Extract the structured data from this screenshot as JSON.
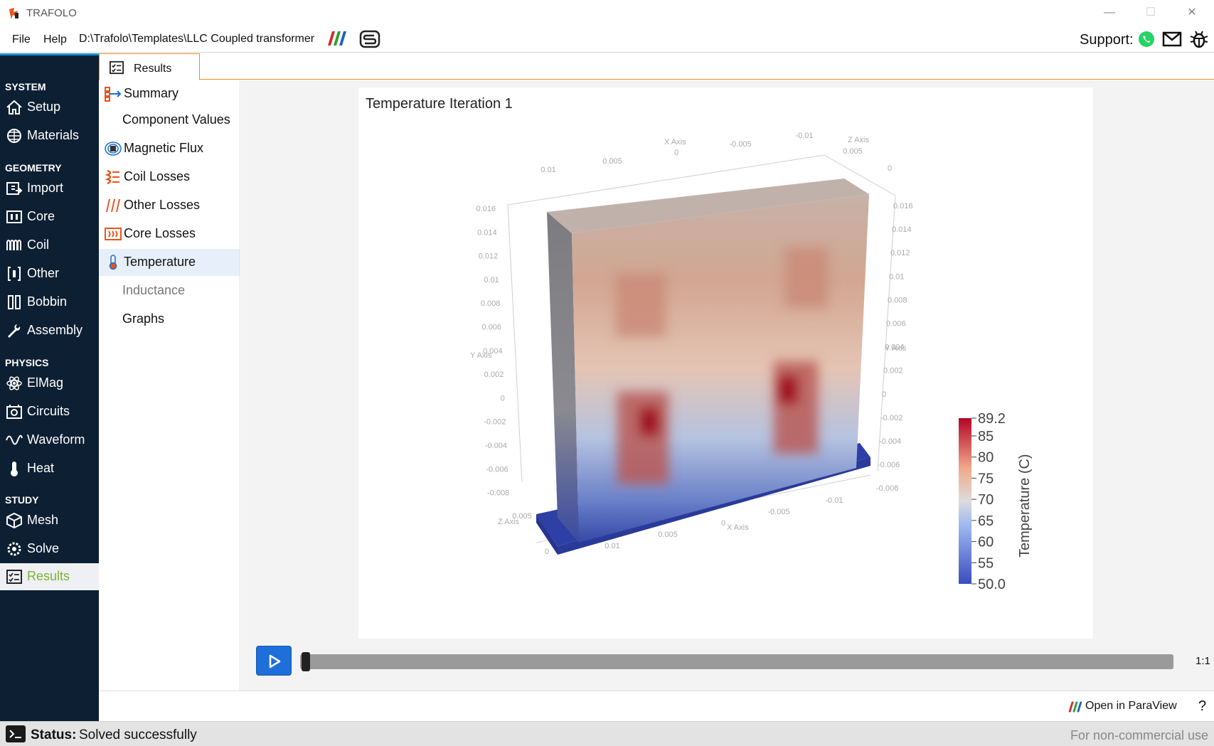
{
  "app": {
    "title": "TRAFOLO"
  },
  "menu": {
    "file": "File",
    "help": "Help",
    "path": "D:\\Trafolo\\Templates\\LLC Coupled transformer"
  },
  "support": {
    "label": "Support:"
  },
  "sidebar": {
    "sections": {
      "system": "SYSTEM",
      "geometry": "GEOMETRY",
      "physics": "PHYSICS",
      "study": "STUDY"
    },
    "items": {
      "setup": "Setup",
      "materials": "Materials",
      "import": "Import",
      "core": "Core",
      "coil": "Coil",
      "other": "Other",
      "bobbin": "Bobbin",
      "assembly": "Assembly",
      "elmag": "ElMag",
      "circuits": "Circuits",
      "waveform": "Waveform",
      "heat": "Heat",
      "mesh": "Mesh",
      "solve": "Solve",
      "results": "Results"
    }
  },
  "tab": {
    "label": "Results"
  },
  "subnav": {
    "summary": "Summary",
    "component_values": "Component Values",
    "magnetic_flux": "Magnetic Flux",
    "coil_losses": "Coil Losses",
    "other_losses": "Other Losses",
    "core_losses": "Core Losses",
    "temperature": "Temperature",
    "inductance": "Inductance",
    "graphs": "Graphs"
  },
  "viewer": {
    "title": "Temperature Iteration 1",
    "axis_labels": {
      "x": "X Axis",
      "y": "Y Axis",
      "z": "Z Axis"
    },
    "colorbar": {
      "title": "Temperature (C)",
      "max": "89.2",
      "min": "50.0",
      "ticks": [
        "85",
        "80",
        "75",
        "70",
        "65",
        "60",
        "55"
      ]
    },
    "y_ticks_left": [
      "0.016",
      "0.014",
      "0.012",
      "0.01",
      "0.008",
      "0.006",
      "0.004",
      "0.002",
      "0",
      "-0.002",
      "-0.004",
      "-0.006",
      "-0.008"
    ],
    "y_ticks_right": [
      "0.016",
      "0.014",
      "0.012",
      "0.01",
      "0.008",
      "0.006",
      "0.004",
      "0.002",
      "0",
      "-0.002",
      "-0.004",
      "-0.006",
      "-0.008"
    ],
    "x_ticks_top": [
      "0.01",
      "0.005",
      "0",
      "-0.005",
      "-0.01"
    ],
    "z_ticks_top": [
      "0.005",
      "0"
    ],
    "x_ticks_bottom": [
      "0.01",
      "0.005",
      "0",
      "-0.005",
      "-0.01"
    ],
    "z_ticks_bottom": [
      "0.005",
      "0"
    ]
  },
  "player": {
    "ratio": "1:1"
  },
  "bottom": {
    "open_paraview": "Open in ParaView",
    "help": "?"
  },
  "status": {
    "label": "Status:",
    "text": "Solved successfully",
    "license": "For non-commercial use"
  },
  "colors": {
    "sidebar_bg": "#0d1f33",
    "accent_orange": "#f08c20",
    "results_green": "#7fb233",
    "play_blue": "#1e6fd9"
  }
}
